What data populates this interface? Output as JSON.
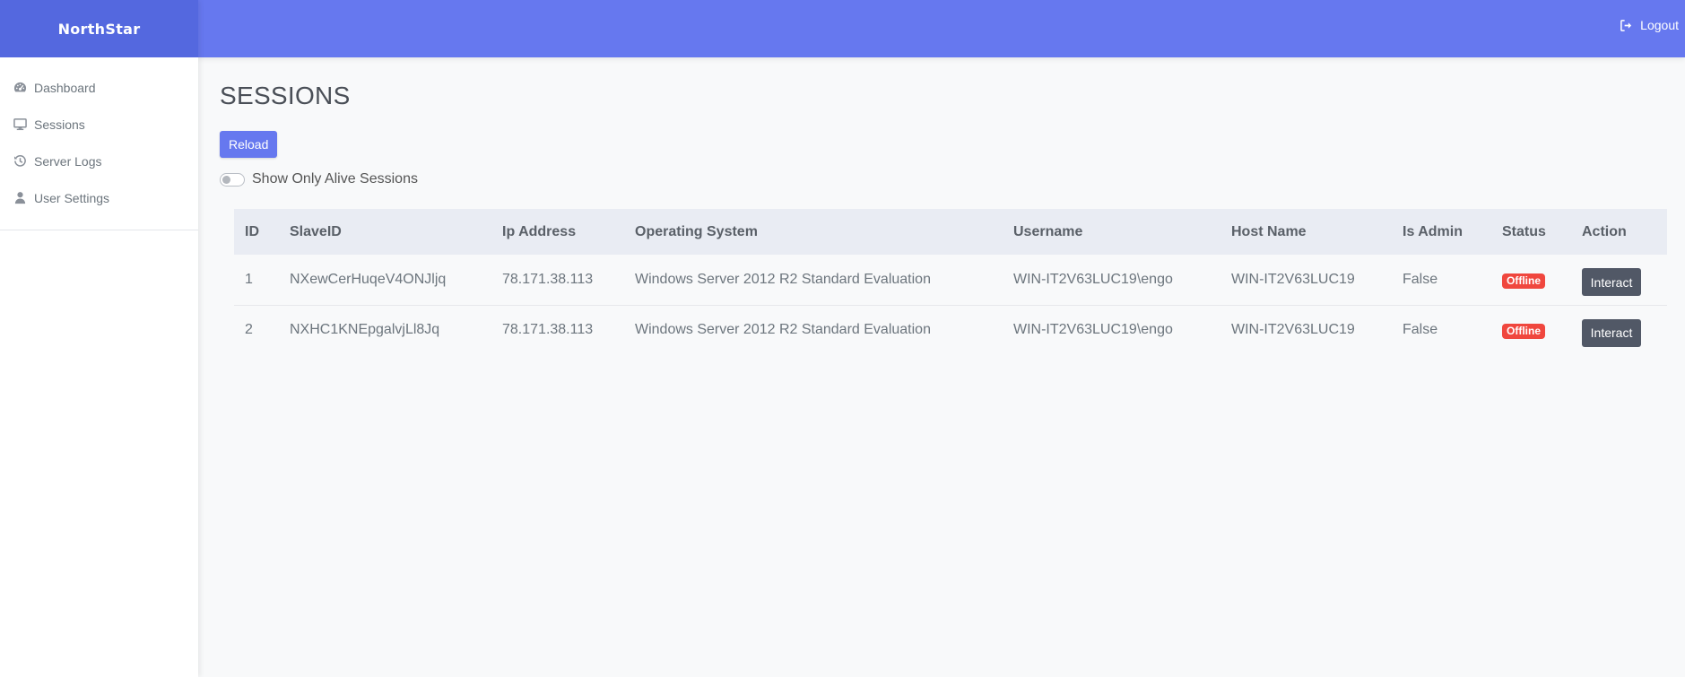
{
  "app": {
    "brand": "NorthStar",
    "accent_color": "#6678ef",
    "brand_color": "#5468df"
  },
  "topbar": {
    "logout_label": "Logout",
    "logout_icon": "sign-out-icon"
  },
  "sidebar": {
    "items": [
      {
        "label": "Dashboard",
        "icon": "tachometer-icon"
      },
      {
        "label": "Sessions",
        "icon": "desktop-icon"
      },
      {
        "label": "Server Logs",
        "icon": "history-icon"
      },
      {
        "label": "User Settings",
        "icon": "user-icon"
      }
    ]
  },
  "main": {
    "title": "SESSIONS",
    "reload_label": "Reload",
    "toggle_label": "Show Only Alive Sessions",
    "toggle_on": false
  },
  "table": {
    "headers": [
      "ID",
      "SlaveID",
      "Ip Address",
      "Operating System",
      "Username",
      "Host Name",
      "Is Admin",
      "Status",
      "Action"
    ],
    "rows": [
      {
        "id": "1",
        "slave_id": "NXewCerHuqeV4ONJljq",
        "ip": "78.171.38.113",
        "os": "Windows Server 2012 R2 Standard Evaluation",
        "username": "WIN-IT2V63LUC19\\engo",
        "host": "WIN-IT2V63LUC19",
        "is_admin": "False",
        "status": "Offline",
        "action": "Interact"
      },
      {
        "id": "2",
        "slave_id": "NXHC1KNEpgalvjLl8Jq",
        "ip": "78.171.38.113",
        "os": "Windows Server 2012 R2 Standard Evaluation",
        "username": "WIN-IT2V63LUC19\\engo",
        "host": "WIN-IT2V63LUC19",
        "is_admin": "False",
        "status": "Offline",
        "action": "Interact"
      }
    ],
    "status_offline_color": "#f0473e"
  }
}
